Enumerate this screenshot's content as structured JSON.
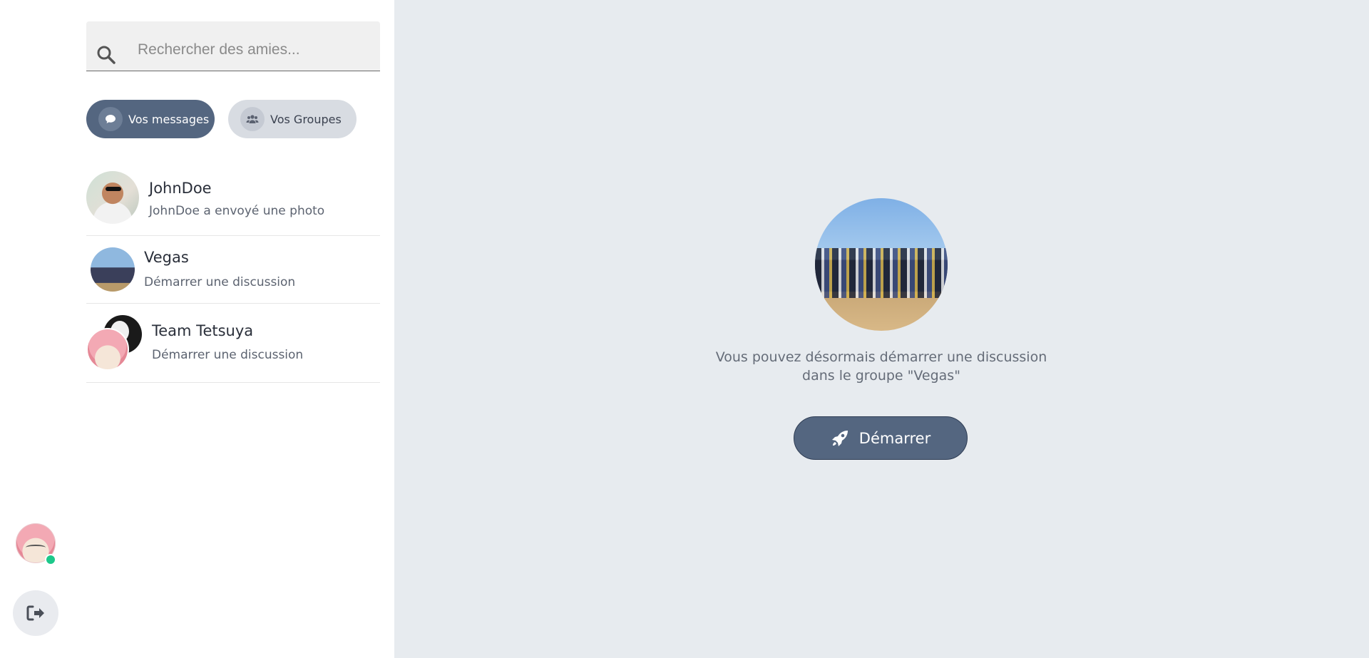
{
  "search": {
    "placeholder": "Rechercher des amies...",
    "icon": "search-icon"
  },
  "tabs": [
    {
      "label": "Vos messages",
      "icon": "chat-bubble-icon",
      "active": true
    },
    {
      "label": "Vos Groupes",
      "icon": "users-icon",
      "active": false
    }
  ],
  "conversations": [
    {
      "name": "JohnDoe",
      "preview": "JohnDoe a envoyé une photo"
    },
    {
      "name": "Vegas",
      "preview": "Démarrer une discussion"
    },
    {
      "name": "Team Tetsuya",
      "preview": "Démarrer une discussion"
    }
  ],
  "main": {
    "message": "Vous pouvez désormais démarrer une discussion dans le groupe \"Vegas\"",
    "start_label": "Démarrer",
    "start_icon": "rocket-icon"
  },
  "rail": {
    "logout_icon": "logout-icon",
    "status_color": "#1cc88a"
  },
  "colors": {
    "accent": "#546680",
    "main_bg": "#e7ebef"
  }
}
